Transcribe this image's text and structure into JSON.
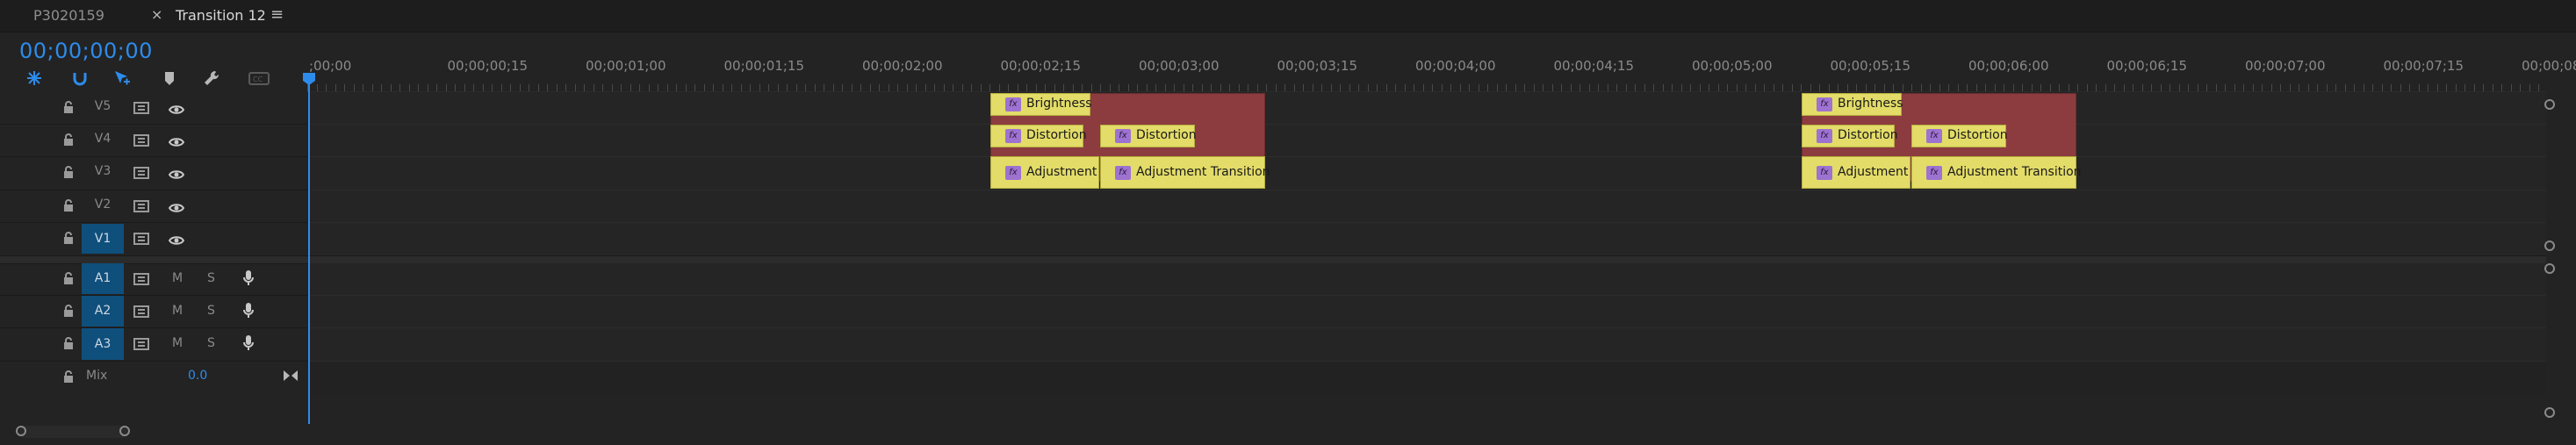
{
  "tabs": [
    {
      "label": "P3020159",
      "active": false
    },
    {
      "label": "Transition 12",
      "active": true
    }
  ],
  "tab_close_glyph": "×",
  "tab_menu_glyph": "≡",
  "timecode": "00;00;00;00",
  "tools": [
    "snap-icon",
    "linked-selection-icon",
    "add-marker-insert-icon",
    "marker-icon",
    "wrench-icon",
    "captions-icon"
  ],
  "ruler_labels": [
    ";00;00",
    "00;00;00;15",
    "00;00;01;00",
    "00;00;01;15",
    "00;00;02;00",
    "00;00;02;15",
    "00;00;03;00",
    "00;00;03;15",
    "00;00;04;00",
    "00;00;04;15",
    "00;00;05;00",
    "00;00;05;15",
    "00;00;06;00",
    "00;00;06;15",
    "00;00;07;00",
    "00;00;07;15",
    "00;00;08;"
  ],
  "video_tracks": [
    {
      "name": "V5",
      "targeted": false
    },
    {
      "name": "V4",
      "targeted": false
    },
    {
      "name": "V3",
      "targeted": false
    },
    {
      "name": "V2",
      "targeted": false
    },
    {
      "name": "V1",
      "targeted": true
    }
  ],
  "audio_tracks": [
    {
      "name": "A1",
      "m": "M",
      "s": "S"
    },
    {
      "name": "A2",
      "m": "M",
      "s": "S"
    },
    {
      "name": "A3",
      "m": "M",
      "s": "S"
    }
  ],
  "mix": {
    "label": "Mix",
    "value": "0.0"
  },
  "clips": {
    "g1_v5_brightness": "Brightness",
    "g1_v4_distortion_a": "Distortion",
    "g1_v4_distortion_b": "Distortion",
    "g1_v3_adjustment": "Adjustment",
    "g1_v3_adjustment_transition": "Adjustment Transition",
    "g2_v5_brightness": "Brightness",
    "g2_v4_distortion_a": "Distortion",
    "g2_v4_distortion_b": "Distortion",
    "g2_v3_adjustment": "Adjustment",
    "g2_v3_adjustment_transition": "Adjustment Transition"
  },
  "fx_badge": "fx",
  "colors": {
    "accent": "#2d8ceb",
    "clip_yellow": "#e3dc68",
    "clip_red": "#8c3c3f",
    "fx_purple": "#9e72d0",
    "target_blue": "#0f4f7c"
  }
}
